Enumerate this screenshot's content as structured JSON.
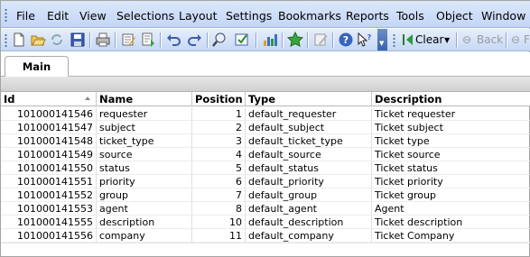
{
  "menu": [
    "File",
    "Edit",
    "View",
    "Selections",
    "Layout",
    "Settings",
    "Bookmarks",
    "Reports",
    "Tools",
    "Object",
    "Window"
  ],
  "toolbar": {
    "icons": [
      "new-icon",
      "open-icon",
      "reload-icon",
      "save-icon",
      "print-icon",
      "edit-script-icon",
      "load-icon",
      "undo-icon",
      "redo-icon",
      "search-icon",
      "check-icon",
      "chart-icon",
      "bookmark-star-icon",
      "edit-icon",
      "help-icon",
      "help-pointer-icon"
    ],
    "clear_label": "Clear",
    "back_label": "Back",
    "forward_label": "F"
  },
  "tabs": [
    {
      "label": "Main"
    }
  ],
  "table": {
    "columns": [
      "Id",
      "Name",
      "Position",
      "Type",
      "Description"
    ],
    "rows": [
      [
        "101000141546",
        "requester",
        "1",
        "default_requester",
        "Ticket requester"
      ],
      [
        "101000141547",
        "subject",
        "2",
        "default_subject",
        "Ticket subject"
      ],
      [
        "101000141548",
        "ticket_type",
        "3",
        "default_ticket_type",
        "Ticket type"
      ],
      [
        "101000141549",
        "source",
        "4",
        "default_source",
        "Ticket source"
      ],
      [
        "101000141550",
        "status",
        "5",
        "default_status",
        "Ticket status"
      ],
      [
        "101000141551",
        "priority",
        "6",
        "default_priority",
        "Ticket priority"
      ],
      [
        "101000141552",
        "group",
        "7",
        "default_group",
        "Ticket group"
      ],
      [
        "101000141553",
        "agent",
        "8",
        "default_agent",
        "Agent"
      ],
      [
        "101000141555",
        "description",
        "10",
        "default_description",
        "Ticket description"
      ],
      [
        "101000141556",
        "company",
        "11",
        "default_company",
        "Ticket Company"
      ]
    ]
  }
}
